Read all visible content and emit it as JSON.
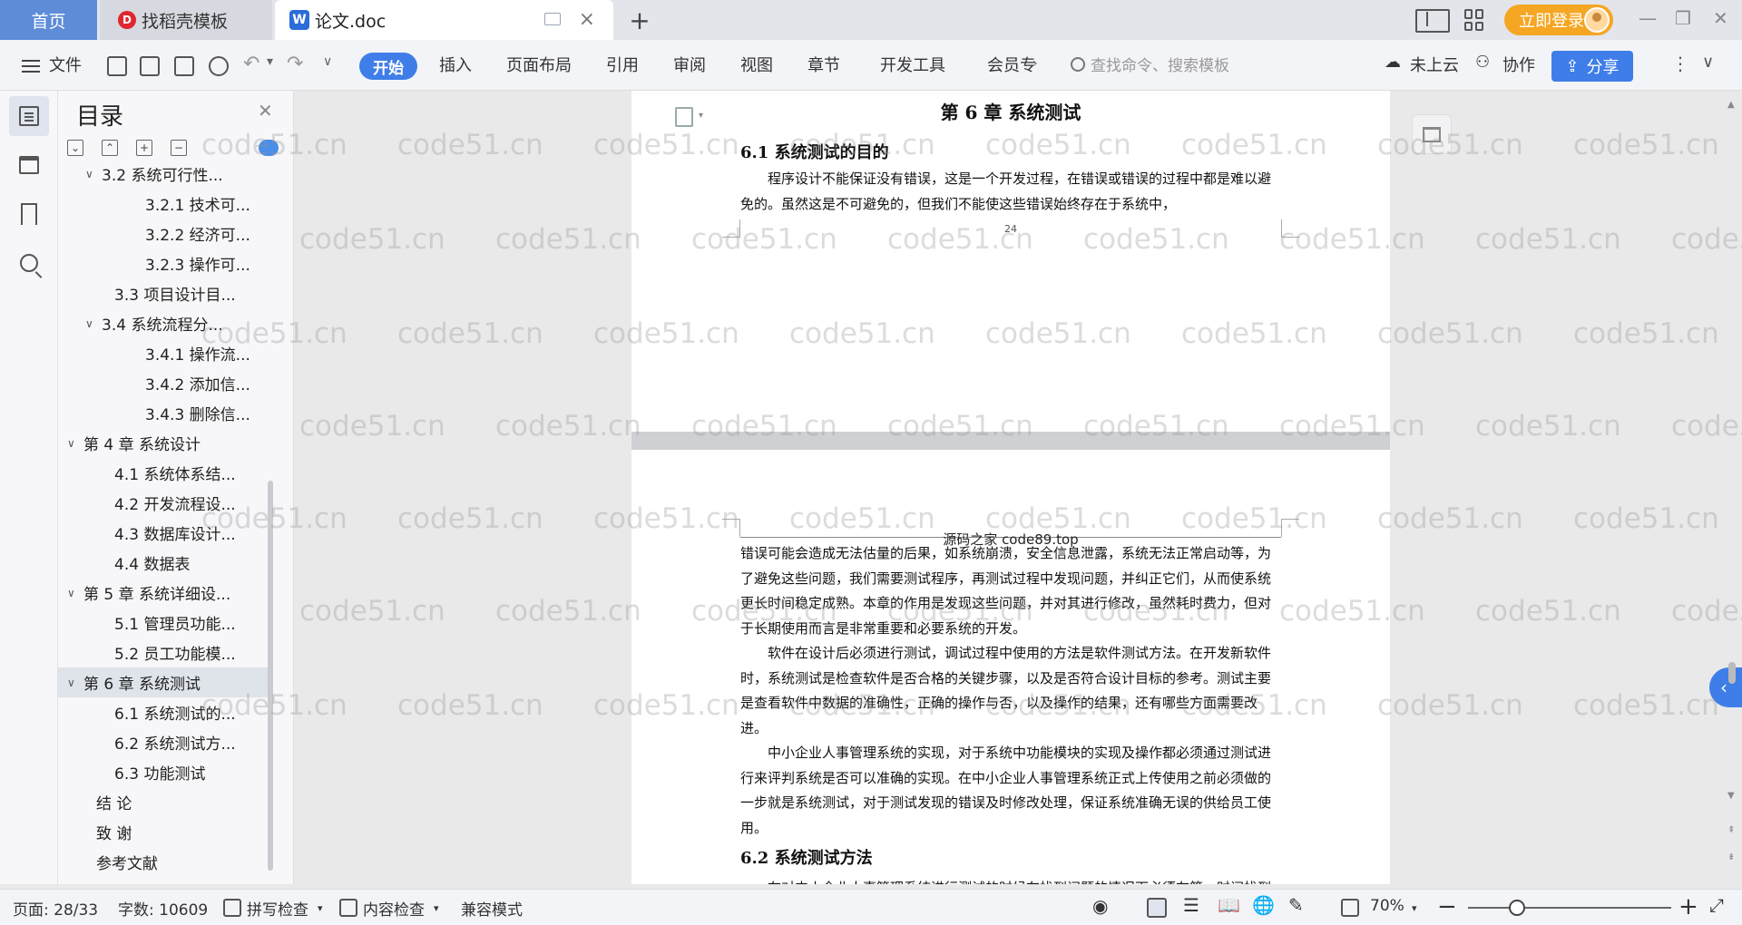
{
  "tabs": {
    "home": "首页",
    "template": "找稻壳模板",
    "template_logo": "D",
    "doc": "论文.doc",
    "doc_logo": "W",
    "add": "+"
  },
  "titlebar": {
    "login": "立即登录",
    "minimize": "—",
    "maximize": "❐",
    "close": "✕"
  },
  "menubar": {
    "file": "文件",
    "ribbon_tabs": [
      "开始",
      "插入",
      "页面布局",
      "引用",
      "审阅",
      "视图",
      "章节",
      "开发工具",
      "会员专"
    ],
    "search_placeholder": "查找命令、搜索模板",
    "cloud": "未上云",
    "collab": "协作",
    "share": "分享"
  },
  "toc": {
    "title": "目录",
    "items": [
      {
        "label": "3.2 系统可行性...",
        "level": 2,
        "expand": "∨"
      },
      {
        "label": "3.2.1 技术可...",
        "level": 3,
        "expand": ""
      },
      {
        "label": "3.2.2 经济可...",
        "level": 3,
        "expand": ""
      },
      {
        "label": "3.2.3 操作可...",
        "level": 3,
        "expand": ""
      },
      {
        "label": "3.3 项目设计目...",
        "level": 2,
        "expand": ""
      },
      {
        "label": "3.4 系统流程分...",
        "level": 2,
        "expand": "∨"
      },
      {
        "label": "3.4.1 操作流...",
        "level": 3,
        "expand": ""
      },
      {
        "label": "3.4.2 添加信...",
        "level": 3,
        "expand": ""
      },
      {
        "label": "3.4.3 删除信...",
        "level": 3,
        "expand": ""
      },
      {
        "label": "第 4 章 系统设计",
        "level": 1,
        "expand": "∨"
      },
      {
        "label": "4.1 系统体系结...",
        "level": 2,
        "expand": ""
      },
      {
        "label": "4.2 开发流程设...",
        "level": 2,
        "expand": ""
      },
      {
        "label": "4.3 数据库设计...",
        "level": 2,
        "expand": ""
      },
      {
        "label": "4.4 数据表",
        "level": 2,
        "expand": ""
      },
      {
        "label": "第 5 章 系统详细设...",
        "level": 1,
        "expand": "∨"
      },
      {
        "label": "5.1 管理员功能...",
        "level": 2,
        "expand": ""
      },
      {
        "label": "5.2 员工功能模...",
        "level": 2,
        "expand": ""
      },
      {
        "label": "第 6 章  系统测试",
        "level": 1,
        "expand": "∨",
        "active": true
      },
      {
        "label": "6.1 系统测试的...",
        "level": 2,
        "expand": ""
      },
      {
        "label": "6.2 系统测试方...",
        "level": 2,
        "expand": ""
      },
      {
        "label": "6.3 功能测试",
        "level": 2,
        "expand": ""
      },
      {
        "label": "结  论",
        "level": 1,
        "expand": ""
      },
      {
        "label": "致  谢",
        "level": 1,
        "expand": ""
      },
      {
        "label": "参考文献",
        "level": 1,
        "expand": ""
      }
    ]
  },
  "document": {
    "chapter_title": "第 6 章   系统测试",
    "sec1_title": "6.1 系统测试的目的",
    "page1_para": "程序设计不能保证没有错误，这是一个开发过程，在错误或错误的过程中都是难以避免的。虽然这是不可避免的，但我们不能使这些错误始终存在于系统中，",
    "page1_number": "24",
    "page2_header": "源码之家 code89.top",
    "page2_para1": "错误可能会造成无法估量的后果，如系统崩溃，安全信息泄露，系统无法正常启动等，为了避免这些问题，我们需要测试程序，再测试过程中发现问题，并纠正它们，从而使系统更长时间稳定成熟。本章的作用是发现这些问题，并对其进行修改，虽然耗时费力，但对于长期使用而言是非常重要和必要系统的开发。",
    "page2_para2": "软件在设计后必须进行测试，调试过程中使用的方法是软件测试方法。在开发新软件时，系统测试是检查软件是否合格的关键步骤，以及是否符合设计目标的参考。测试主要是查看软件中数据的准确性，正确的操作与否，以及操作的结果，还有哪些方面需要改进。",
    "page2_para3": "中小企业人事管理系统的实现，对于系统中功能模块的实现及操作都必须通过测试进行来评判系统是否可以准确的实现。在中小企业人事管理系统正式上传使用之前必须做的一步就是系统测试，对于测试发现的错误及时修改处理，保证系统准确无误的供给员工使用。",
    "sec2_title": "6.2 系统测试方法",
    "page2_para4": "在对中小企业人事管理系统进行测试的时候在找到问题的情况下必须在第一时间找到解决问题的办法，不要存在侥幸的心理，这样才能让中小企业人事管理系统开发的质量可以过关，并且开发的周期会大大缩短，还有就是在测试时，不"
  },
  "watermark": "code51.cn",
  "statusbar": {
    "page": "页面: 28/33",
    "words": "字数: 10609",
    "spell": "拼写检查",
    "content_check": "内容检查",
    "compat": "兼容模式",
    "zoom": "70%",
    "zoom_level": 0.24
  },
  "icons": {
    "toc": "toc-icon",
    "nav": "navigation-icon",
    "bookmark": "bookmark-icon",
    "search": "search-icon"
  },
  "colors": {
    "accent": "#3f7ee8",
    "login": "#f5a623",
    "home_tab": "#5f8cd8"
  }
}
